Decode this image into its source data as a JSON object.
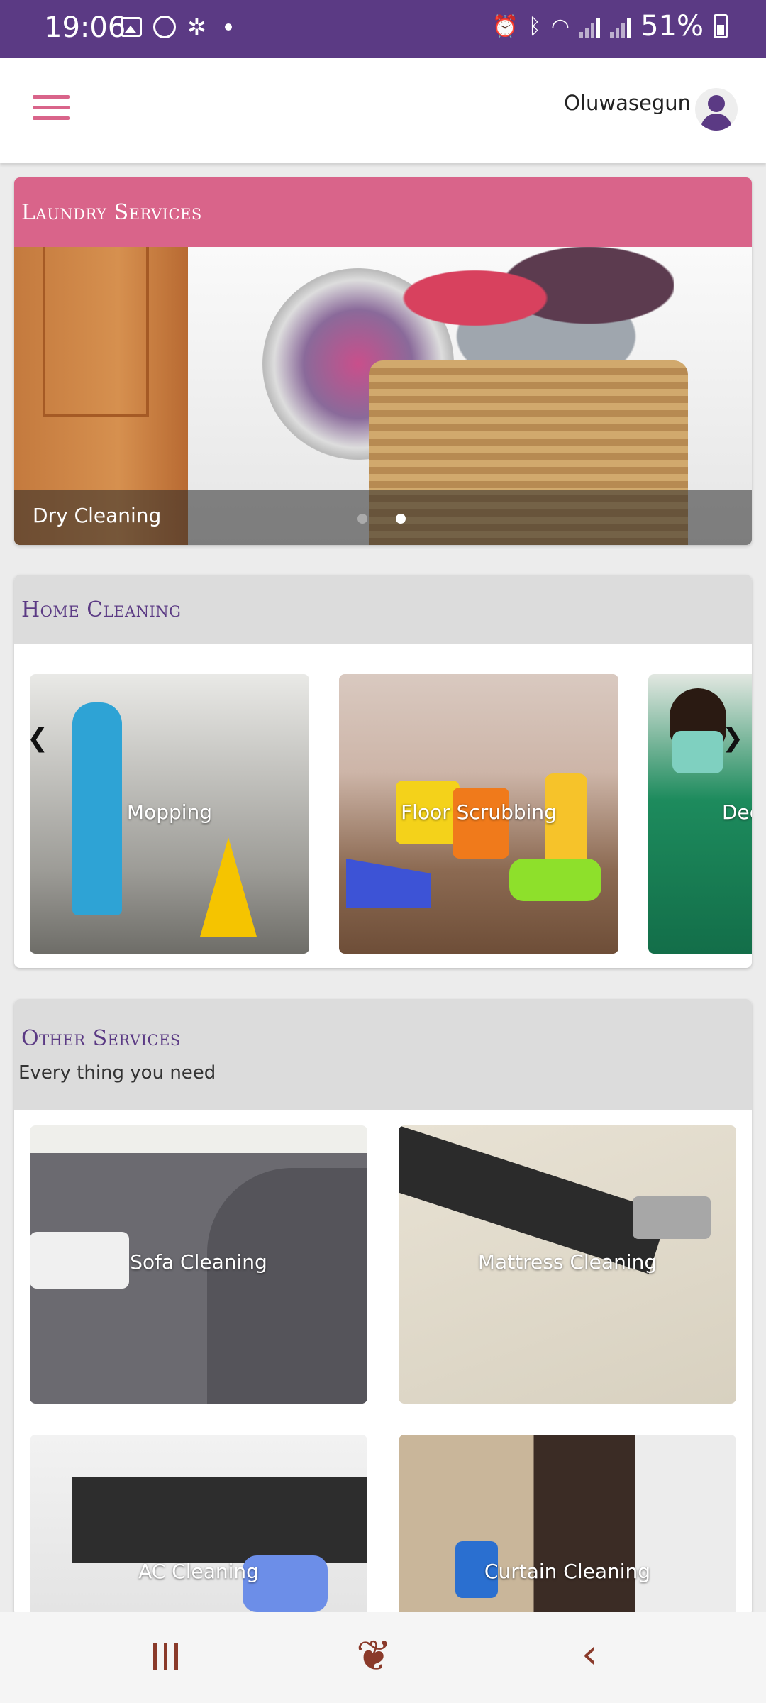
{
  "status_bar": {
    "time": "19:06",
    "battery": "51%"
  },
  "header": {
    "username": "Oluwasegun"
  },
  "laundry": {
    "title": "Laundry Services",
    "slide_caption": "Dry Cleaning",
    "slides_total": 2,
    "active_slide": 2
  },
  "home_cleaning": {
    "title": "Home Cleaning",
    "items": [
      {
        "label": "Mopping"
      },
      {
        "label": "Floor Scrubbing"
      },
      {
        "label": "Dee"
      }
    ]
  },
  "other_services": {
    "title": "Other Services",
    "subtitle": "Every thing you need",
    "items": [
      {
        "label": "Sofa Cleaning"
      },
      {
        "label": "Mattress Cleaning"
      },
      {
        "label": "AC Cleaning"
      },
      {
        "label": "Curtain Cleaning"
      }
    ]
  },
  "colors": {
    "primary": "#5b3a84",
    "accent": "#d9648a",
    "nav_icon": "#8a3a2a"
  },
  "icons": {
    "menu": "hamburger-icon",
    "profile": "user-icon",
    "prev": "chevron-left-icon",
    "next": "chevron-right-icon",
    "nav_recents": "recents-icon",
    "nav_home": "home-icon",
    "nav_back": "back-icon"
  }
}
